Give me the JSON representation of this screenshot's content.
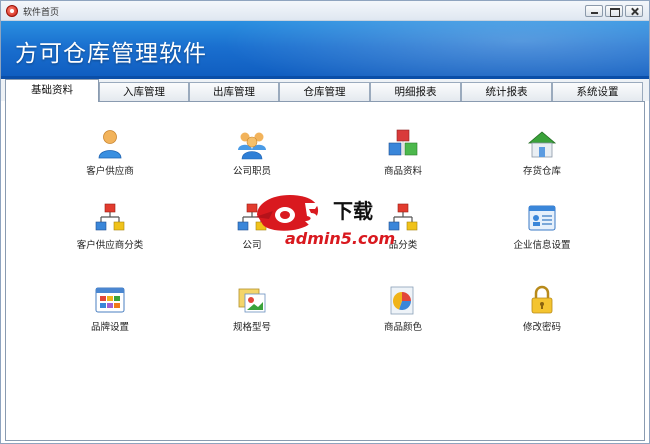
{
  "window": {
    "title": "软件首页"
  },
  "banner": {
    "app_title": "方可仓库管理软件"
  },
  "tabs": [
    {
      "label": "基础资料",
      "active": true
    },
    {
      "label": "入库管理"
    },
    {
      "label": "出库管理"
    },
    {
      "label": "仓库管理"
    },
    {
      "label": "明细报表"
    },
    {
      "label": "统计报表"
    },
    {
      "label": "系统设置"
    }
  ],
  "items": [
    {
      "label": "客户供应商",
      "icon": "person-icon"
    },
    {
      "label": "公司职员",
      "icon": "people-group-icon"
    },
    {
      "label": "商品资料",
      "icon": "cubes-icon"
    },
    {
      "label": "存货仓库",
      "icon": "house-icon"
    },
    {
      "label": "客户供应商分类",
      "icon": "org-chart-icon"
    },
    {
      "label": "公司",
      "icon": "org-chart-icon"
    },
    {
      "label": "品分类",
      "icon": "org-chart-icon"
    },
    {
      "label": "企业信息设置",
      "icon": "id-card-icon"
    },
    {
      "label": "品牌设置",
      "icon": "grid-window-icon"
    },
    {
      "label": "规格型号",
      "icon": "photo-card-icon"
    },
    {
      "label": "商品颜色",
      "icon": "color-chart-icon"
    },
    {
      "label": "修改密码",
      "icon": "lock-icon"
    }
  ],
  "watermark": {
    "text": "admin5.com",
    "mark": "下载"
  },
  "colors": {
    "banner": "#1a6fcf",
    "watermark": "#d9191f"
  }
}
